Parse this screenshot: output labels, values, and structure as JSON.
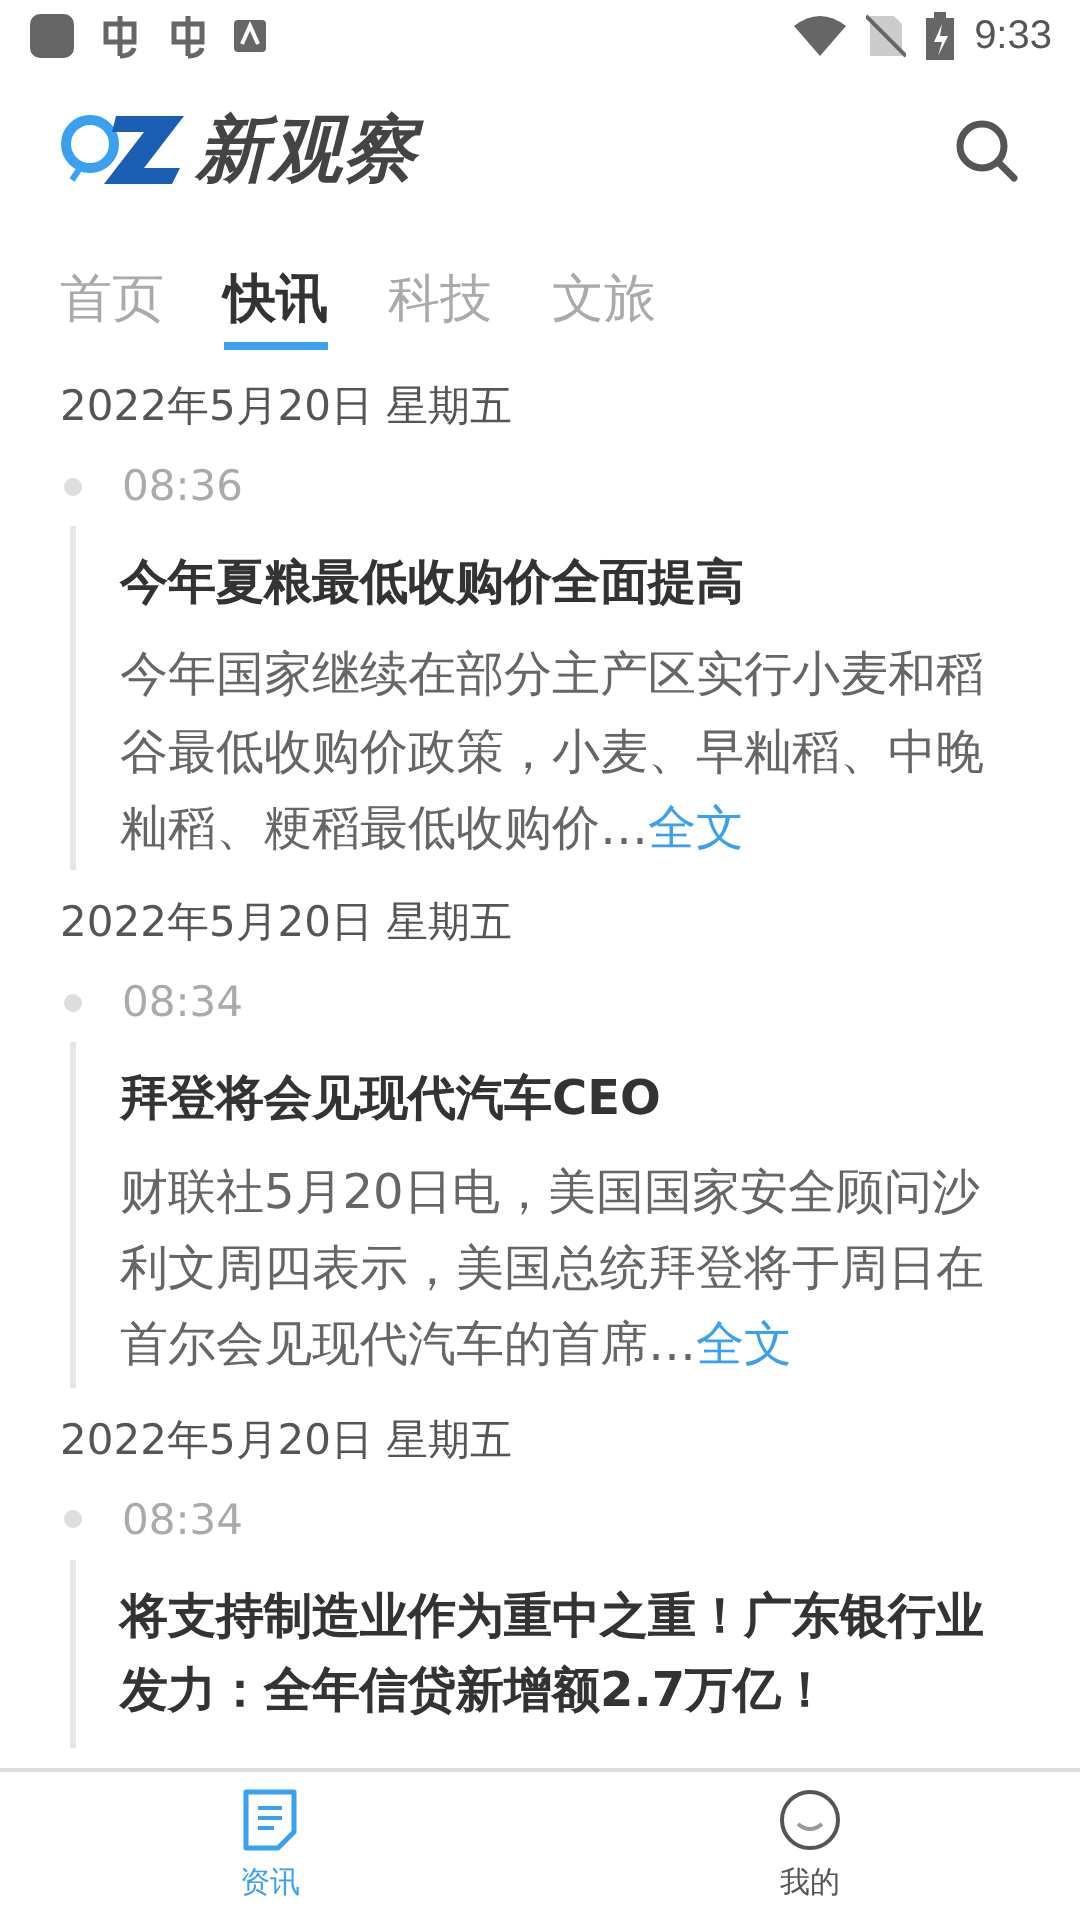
{
  "status_bar": {
    "time": "9:33"
  },
  "header": {
    "logo_text": "新观察"
  },
  "tabs": [
    {
      "label": "首页",
      "selected": false
    },
    {
      "label": "快讯",
      "selected": true
    },
    {
      "label": "科技",
      "selected": false
    },
    {
      "label": "文旅",
      "selected": false
    }
  ],
  "feed": [
    {
      "date": "2022年5月20日 星期五",
      "time": "08:36",
      "title": "今年夏粮最低收购价全面提高",
      "summary": "今年国家继续在部分主产区实行小麦和稻谷最低收购价政策，小麦、早籼稻、中晚籼稻、粳稻最低收购价…",
      "link": "全文"
    },
    {
      "date": "2022年5月20日 星期五",
      "time": "08:34",
      "title": "拜登将会见现代汽车CEO",
      "summary": "财联社5月20日电，美国国家安全顾问沙利文周四表示，美国总统拜登将于周日在首尔会见现代汽车的首席…",
      "link": "全文"
    },
    {
      "date": "2022年5月20日 星期五",
      "time": "08:34",
      "title": "将支持制造业作为重中之重！广东银行业发力：全年信贷新增额2.7万亿！"
    }
  ],
  "bottom_nav": [
    {
      "label": "资讯",
      "kind": "news",
      "selected": true
    },
    {
      "label": "我的",
      "kind": "profile",
      "selected": false
    }
  ]
}
